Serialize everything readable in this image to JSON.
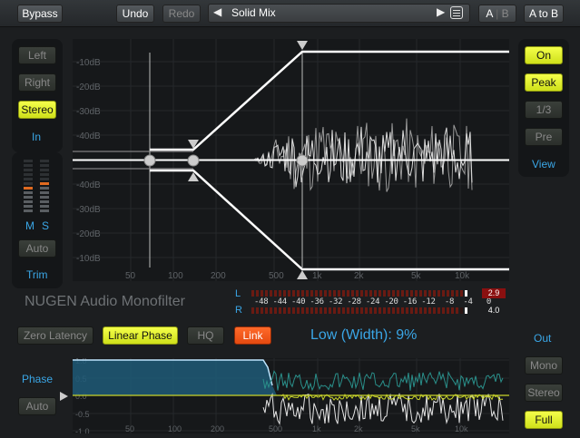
{
  "topbar": {
    "bypass": "Bypass",
    "undo": "Undo",
    "redo": "Redo",
    "preset_name": "Solid Mix",
    "a_label": "A",
    "b_label": "B",
    "a_to_b": "A to B"
  },
  "left_panel": {
    "left": "Left",
    "right": "Right",
    "stereo": "Stereo",
    "in_label": "In",
    "m_label": "M",
    "s_label": "S",
    "auto": "Auto",
    "trim": "Trim"
  },
  "right_panel": {
    "on": "On",
    "peak": "Peak",
    "third": "1/3",
    "pre": "Pre",
    "view": "View"
  },
  "graph": {
    "db_ticks": [
      "-10dB",
      "-20dB",
      "-30dB",
      "-40dB",
      "-40dB",
      "-30dB",
      "-20dB",
      "-10dB"
    ],
    "freq_ticks": [
      "50",
      "100",
      "200",
      "500",
      "1k",
      "2k",
      "5k",
      "10k"
    ]
  },
  "brand": "NUGEN Audio Monofilter",
  "meters": {
    "l_label": "L",
    "r_label": "R",
    "scale": "-48 -44 -40 -36 -32 -28 -24 -20 -16 -12  -8  -4   0",
    "l_peak": "2.9",
    "r_peak": "4.0"
  },
  "mode_buttons": {
    "zero_latency": "Zero Latency",
    "linear_phase": "Linear Phase",
    "hq": "HQ",
    "link": "Link"
  },
  "width_readout": "Low (Width): 9%",
  "phase": {
    "label": "Phase",
    "auto": "Auto",
    "ticks": [
      "1.0",
      "0.5",
      "0.0",
      "-0.5",
      "-1.0"
    ],
    "freq_ticks": [
      "50",
      "100",
      "200",
      "500",
      "1k",
      "2k",
      "5k",
      "10k"
    ]
  },
  "out_panel": {
    "out": "Out",
    "mono": "Mono",
    "stereo": "Stereo",
    "full": "Full"
  },
  "colors": {
    "accent_blue": "#3aa6e6",
    "lit_yellow": "#e8f52a",
    "link_orange": "#ff5a1e",
    "phase_teal": "#2a8f8a"
  }
}
